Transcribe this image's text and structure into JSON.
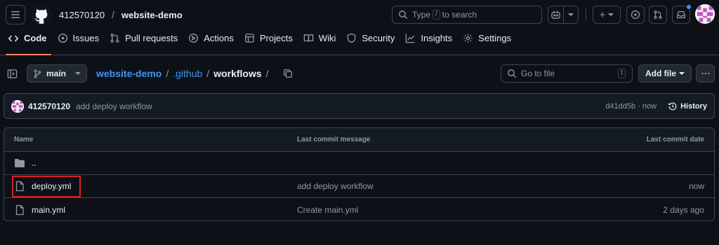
{
  "header": {
    "owner": "412570120",
    "separator": "/",
    "repo": "website-demo",
    "search_prefix": "Type",
    "search_key": "/",
    "search_suffix": "to search"
  },
  "tabs": [
    {
      "label": "Code",
      "icon": "code-icon",
      "active": true
    },
    {
      "label": "Issues",
      "icon": "issue-opened-icon"
    },
    {
      "label": "Pull requests",
      "icon": "git-pull-request-icon"
    },
    {
      "label": "Actions",
      "icon": "play-icon"
    },
    {
      "label": "Projects",
      "icon": "table-icon"
    },
    {
      "label": "Wiki",
      "icon": "book-icon"
    },
    {
      "label": "Security",
      "icon": "shield-icon"
    },
    {
      "label": "Insights",
      "icon": "graph-icon"
    },
    {
      "label": "Settings",
      "icon": "gear-icon"
    }
  ],
  "nav": {
    "branch": "main",
    "path": {
      "repo": "website-demo",
      "folder": ".github",
      "current": "workflows",
      "sep": "/"
    },
    "go_to_file_placeholder": "Go to file",
    "go_to_file_key": "t",
    "add_file": "Add file"
  },
  "latest_commit": {
    "author": "412570120",
    "message": "add deploy workflow",
    "sha_time": "d41dd5b · now",
    "history": "History"
  },
  "table": {
    "columns": [
      "Name",
      "Last commit message",
      "Last commit date"
    ],
    "parent": "..",
    "rows": [
      {
        "name": "deploy.yml",
        "message": "add deploy workflow",
        "date": "now",
        "highlighted": true
      },
      {
        "name": "main.yml",
        "message": "Create main.yml",
        "date": "2 days ago"
      }
    ]
  },
  "colors": {
    "background": "#0d1117",
    "border": "#3d444d",
    "link": "#4493f8",
    "tab_underline": "#f78166",
    "highlight_box": "#d82020"
  }
}
